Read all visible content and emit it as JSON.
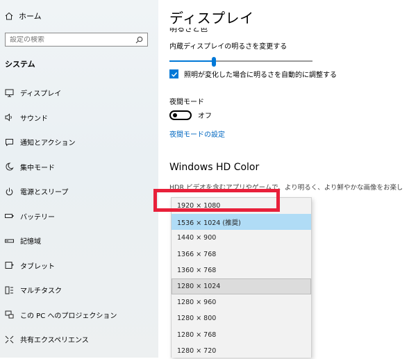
{
  "sidebar": {
    "home_label": "ホーム",
    "search_placeholder": "設定の検索",
    "section_title": "システム",
    "items": [
      {
        "label": "ディスプレイ",
        "icon": "monitor-icon"
      },
      {
        "label": "サウンド",
        "icon": "speaker-icon"
      },
      {
        "label": "通知とアクション",
        "icon": "notification-icon"
      },
      {
        "label": "集中モード",
        "icon": "moon-icon"
      },
      {
        "label": "電源とスリープ",
        "icon": "power-icon"
      },
      {
        "label": "バッテリー",
        "icon": "battery-icon"
      },
      {
        "label": "記憶域",
        "icon": "storage-icon"
      },
      {
        "label": "タブレット",
        "icon": "tablet-icon"
      },
      {
        "label": "マルチタスク",
        "icon": "multitask-icon"
      },
      {
        "label": "この PC へのプロジェクション",
        "icon": "projection-icon"
      },
      {
        "label": "共有エクスペリエンス",
        "icon": "share-icon"
      }
    ]
  },
  "main": {
    "title": "ディスプレイ",
    "brightness_label": "内蔵ディスプレイの明るさを変更する",
    "brightness_level": 0.31,
    "auto_brightness_label": "照明が変化した場合に明るさを自動的に調整する",
    "auto_brightness_checked": true,
    "night_mode_label": "夜間モード",
    "night_mode_state": "オフ",
    "night_mode_settings_link": "夜間モードの設定",
    "hd_color_title": "Windows HD Color",
    "hd_color_desc": "HDR ビデオを含むアプリやゲームで、より明るく、より鮮やかな画像をお楽しみいただけます。"
  },
  "resolution_dropdown": {
    "options": [
      "1920 × 1080",
      "1536 × 1024 (推奨)",
      "1440 × 900",
      "1366 × 768",
      "1360 × 768",
      "1280 × 1024",
      "1280 × 960",
      "1280 × 800",
      "1280 × 768",
      "1280 × 720"
    ],
    "selected": "1536 × 1024 (推奨)",
    "hovered": "1280 × 1024"
  },
  "colors": {
    "accent": "#0078d7",
    "link": "#0067c0",
    "selected_bg": "#b0dcf6",
    "highlight_box": "#e8203a"
  }
}
